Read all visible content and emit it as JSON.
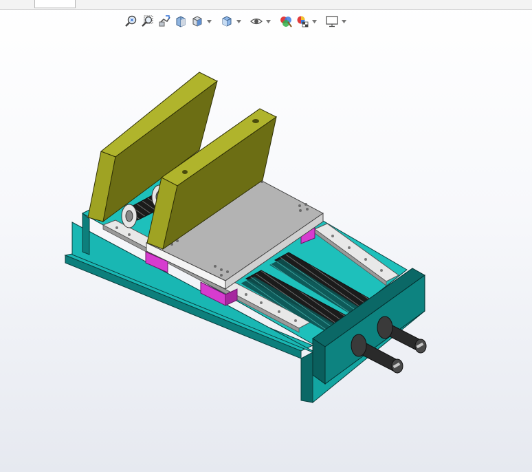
{
  "window": {
    "accent": "#2f6fd6"
  },
  "toolbar": {
    "items": [
      {
        "name": "zoom-to-fit-icon",
        "dropdown": false
      },
      {
        "name": "zoom-to-area-icon",
        "dropdown": false
      },
      {
        "name": "previous-view-icon",
        "dropdown": false
      },
      {
        "name": "section-view-icon",
        "dropdown": false
      },
      {
        "name": "view-orientation-icon",
        "dropdown": true
      },
      {
        "name": "display-style-icon",
        "dropdown": true
      },
      {
        "name": "hide-show-items-icon",
        "dropdown": true
      },
      {
        "name": "edit-appearance-icon",
        "dropdown": false
      },
      {
        "name": "apply-scene-icon",
        "dropdown": true
      },
      {
        "name": "view-settings-icon",
        "dropdown": true
      }
    ]
  },
  "model": {
    "name": "vise-assembly",
    "colors": {
      "base": "#19b7b3",
      "base_dark": "#0d7f7c",
      "base_shadow": "#0a5f5d",
      "jaw_plate": "#9fa323",
      "jaw_plate_dark": "#6c6e14",
      "slide_plate": "#b3b3b3",
      "slide_plate_light": "#d0d0d0",
      "pad": "#d63ccf",
      "screw": "#2c2c2c",
      "rail": "#e8e8e8"
    }
  }
}
